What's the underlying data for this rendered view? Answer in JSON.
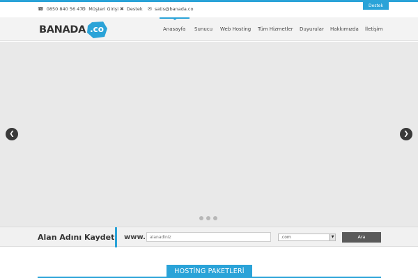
{
  "topbar": {
    "phone": "0850 840 56 47",
    "customer_login": "Müşteri Girişi",
    "support": "Destek",
    "email": "satis@banada.co",
    "support_tab": "Destek",
    "icons": [
      "phone-icon",
      "gears-icon",
      "tools-icon",
      "mail-icon"
    ]
  },
  "logo": {
    "text": "BANADA",
    "badge": ".co",
    "brand_color": "#2aa3d8"
  },
  "nav": {
    "items": [
      "Anasayfa",
      "Sunucu",
      "Web Hosting",
      "Tüm Hizmetler",
      "Duyurular",
      "Hakkımızda",
      "İletişim"
    ],
    "active": "Anasayfa"
  },
  "slider": {
    "prev_icon": "chevron-left-icon",
    "next_icon": "chevron-right-icon",
    "dot_count": 3
  },
  "domain_search": {
    "title": "Alan Adını Kaydet",
    "prefix": "www.",
    "placeholder": "alanadiniz",
    "tld": ".com",
    "button": "Ara"
  },
  "section": {
    "title": "HOSTİNG PAKETLERİ"
  }
}
